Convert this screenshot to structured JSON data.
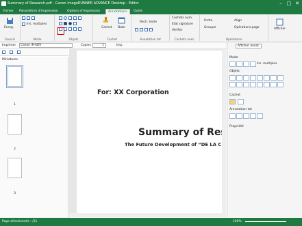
{
  "window": {
    "title": "Summary of Research.pdf - Canon imageRUNNER ADVANCE Desktop - Editor",
    "minimize": "–",
    "maximize": "□",
    "close": "✕"
  },
  "tabs": [
    "Fichier",
    "Paramètres d'impression",
    "Options d'impression",
    "Annotations",
    "Outils"
  ],
  "ribbon": {
    "groups": [
      "Favoris",
      "Mode",
      "Objets",
      "Cachet",
      "Annotation txt",
      "Cachets num.",
      "Opérations"
    ],
    "enreg": "Enreg.",
    "ins_multiples": "Ins. multiples",
    "cachet": "Cachet",
    "date": "Date",
    "rech_texte": "Rech. texte",
    "cachets_num": "Cachets num.",
    "etat_signature": "Etat signature",
    "verifier": "Vérifier",
    "ordre": "Ordre",
    "grouper": "Grouper",
    "align": "Align",
    "operations_page": "Opérations page",
    "afficher": "Afficher"
  },
  "toolbar": {
    "imprimer": "Imprimer",
    "printer": "Canon iR-ADV",
    "copies_label": "Copies",
    "copies": "1",
    "imp": "Imp."
  },
  "thumbnails": {
    "title": "Miniatures",
    "pages": [
      "1",
      "2",
      "3"
    ]
  },
  "document": {
    "for": "For: XX Corporation",
    "title": "Summary of Rese",
    "subtitle": "The Future Development of “DE LA C"
  },
  "panel": {
    "afficher_annot": "Afficher annot.",
    "mode": "Mode",
    "ins_multiples": "Ins. multiples",
    "objets": "Objets",
    "cachet": "Cachet",
    "annotation_txt": "Annotation txt",
    "propriete": "Propriété"
  },
  "status": {
    "page": "Page sélectionnée : /11",
    "zoom": "100%"
  }
}
